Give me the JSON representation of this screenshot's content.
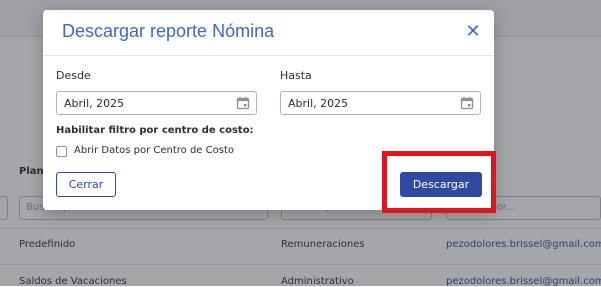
{
  "background": {
    "columns": [
      "Plant",
      "",
      ""
    ],
    "filters": [
      "Buscar por...",
      "Buscar por...",
      "Buscar por..."
    ],
    "rows": [
      {
        "name": "Predefinido",
        "type": "Remuneraciones",
        "email": "pezodolores.brissel@gmail.com"
      },
      {
        "name": "Saldos de Vacaciones",
        "type": "Administrativo",
        "email": "pezodolores.brissel@gmail.com"
      }
    ]
  },
  "modal": {
    "title": "Descargar reporte Nómina",
    "close_icon": "close-icon",
    "desde_label": "Desde",
    "desde_value": "Abril, 2025",
    "hasta_label": "Hasta",
    "hasta_value": "Abril, 2025",
    "filter_section_label": "Habilitar filtro por centro de costo:",
    "checkbox_label": "Abrir Datos por Centro de Costo",
    "checkbox_checked": false,
    "cerrar_label": "Cerrar",
    "descargar_label": "Descargar"
  },
  "colors": {
    "accent": "#3c68c7",
    "primary_button": "#2f4aa0",
    "highlight": "#e0141c"
  }
}
